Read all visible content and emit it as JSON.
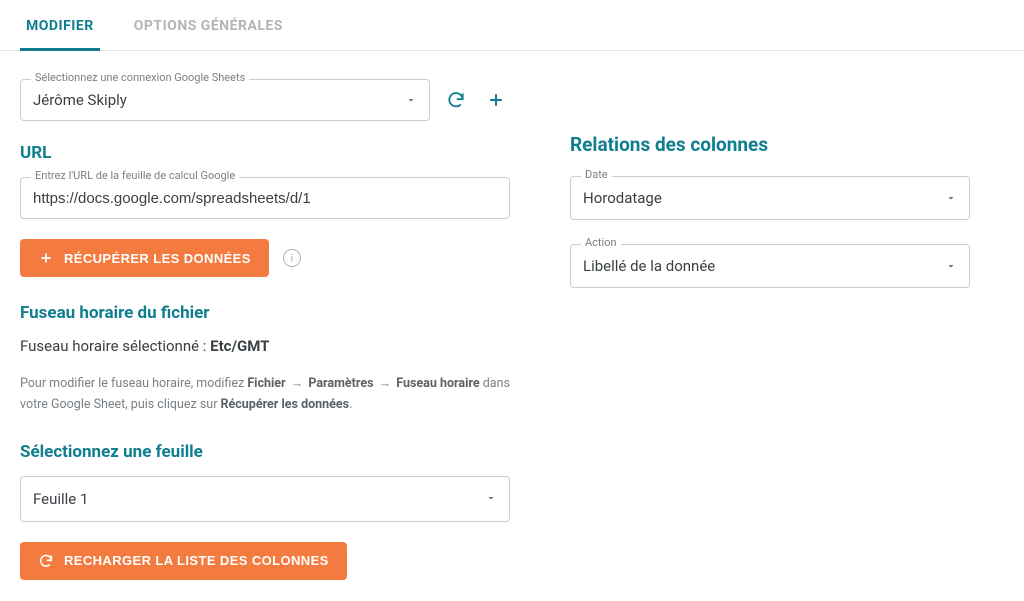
{
  "tabs": {
    "modify": "MODIFIER",
    "general": "OPTIONS GÉNÉRALES"
  },
  "connection": {
    "label": "Sélectionnez une connexion Google Sheets",
    "value": "Jérôme Skiply"
  },
  "url": {
    "heading": "URL",
    "label": "Entrez l'URL de la feuille de calcul Google",
    "value": "https://docs.google.com/spreadsheets/d/1"
  },
  "buttons": {
    "fetch": "RÉCUPÉRER LES DONNÉES",
    "reload_cols": "RECHARGER LA LISTE DES COLONNES"
  },
  "timezone": {
    "heading": "Fuseau horaire du fichier",
    "selected_prefix": "Fuseau horaire sélectionné : ",
    "selected_value": "Etc/GMT",
    "help_pre": "Pour modifier le fuseau horaire, modifiez ",
    "help_b1": "Fichier",
    "help_b2": "Paramètres",
    "help_b3": "Fuseau horaire",
    "help_mid": " dans votre Google Sheet, puis cliquez sur ",
    "help_b4": "Récupérer les données",
    "help_end": "."
  },
  "sheet": {
    "heading": "Sélectionnez une feuille",
    "value": "Feuille 1"
  },
  "relations": {
    "heading": "Relations des colonnes",
    "date_label": "Date",
    "date_value": "Horodatage",
    "action_label": "Action",
    "action_value": "Libellé de la donnée"
  },
  "icons": {
    "info_char": "i"
  }
}
